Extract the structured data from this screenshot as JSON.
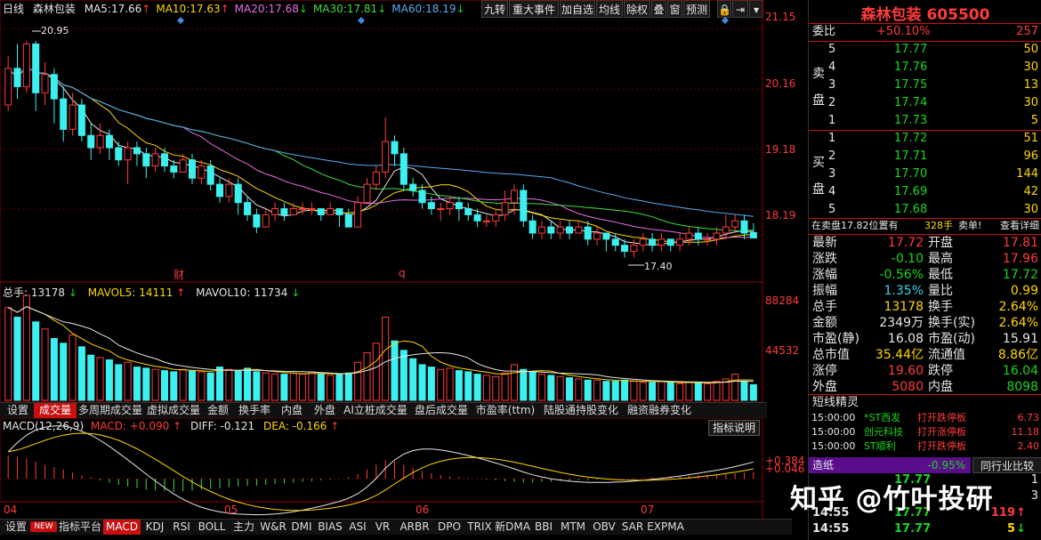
{
  "header": {
    "period": "日线",
    "name": "森林包装",
    "ma": [
      {
        "label": "MA5:",
        "value": "17.66",
        "arrow": "↑",
        "cls": "ma5"
      },
      {
        "label": "MA10:",
        "value": "17.63",
        "arrow": "↑",
        "cls": "ma10"
      },
      {
        "label": "MA20:",
        "value": "17.68",
        "arrow": "↓",
        "cls": "ma20"
      },
      {
        "label": "MA30:",
        "value": "17.81",
        "arrow": "↓",
        "cls": "ma30"
      },
      {
        "label": "MA60:",
        "value": "18.19",
        "arrow": "↓",
        "cls": "ma60"
      }
    ],
    "buttons": [
      "九转",
      "重大事件",
      "加自选",
      "均线",
      "除权",
      "叠",
      "窗",
      "预测"
    ]
  },
  "price_axis": [
    "21.15",
    "20.16",
    "19.18",
    "18.19"
  ],
  "price_annotations": {
    "high": "20.95",
    "low": "17.40",
    "mark_cai": "财",
    "mark_q": "q"
  },
  "volume": {
    "total_label": "总手:",
    "total": "13178",
    "total_arrow": "↓",
    "mavol5_label": "MAVOL5:",
    "mavol5": "14111",
    "mavol5_arrow": "↑",
    "mavol10_label": "MAVOL10:",
    "mavol10": "11734",
    "mavol10_arrow": "↓",
    "axis": [
      "88284",
      "44532"
    ]
  },
  "tabs1": [
    "设置",
    "成交量",
    "多周期成交量",
    "虚拟成交量",
    "金额",
    "换手率",
    "内盘",
    "外盘",
    "AI立桩成交量",
    "盘后成交量",
    "市盈率(ttm)",
    "陆股通持股变化",
    "融资融券变化"
  ],
  "macd": {
    "title": "MACD(12,26,9)",
    "macd_label": "MACD:",
    "macd": "+0.090",
    "diff_label": "DIFF:",
    "diff": "-0.121",
    "dea_label": "DEA:",
    "dea": "-0.166",
    "arrow": "↑",
    "explain": "指标说明",
    "axis": [
      "+0.384",
      "+0.046"
    ]
  },
  "months": [
    "04",
    "05",
    "06",
    "07"
  ],
  "tabs2": [
    "设置",
    "NEW",
    "指标平台",
    "MACD",
    "KDJ",
    "RSI",
    "BOLL",
    "主力",
    "W&R",
    "DMI",
    "BIAS",
    "ASI",
    "VR",
    "ARBR",
    "DPO",
    "TRIX",
    "新DMA",
    "BBI",
    "MTM",
    "OBV",
    "SAR",
    "EXPMA"
  ],
  "panel": {
    "title": "森林包装 605500",
    "weibi_label": "委比",
    "weibi": "+50.10%",
    "weibi_diff": "257",
    "sell_label": [
      "卖",
      "盘"
    ],
    "buy_label": [
      "买",
      "盘"
    ],
    "asks": [
      {
        "lvl": "5",
        "price": "17.77",
        "vol": "50"
      },
      {
        "lvl": "4",
        "price": "17.76",
        "vol": "30"
      },
      {
        "lvl": "3",
        "price": "17.75",
        "vol": "13"
      },
      {
        "lvl": "2",
        "price": "17.74",
        "vol": "30"
      },
      {
        "lvl": "1",
        "price": "17.73",
        "vol": "5"
      }
    ],
    "bids": [
      {
        "lvl": "1",
        "price": "17.72",
        "vol": "51"
      },
      {
        "lvl": "2",
        "price": "17.71",
        "vol": "96"
      },
      {
        "lvl": "3",
        "price": "17.70",
        "vol": "144"
      },
      {
        "lvl": "4",
        "price": "17.69",
        "vol": "42"
      },
      {
        "lvl": "5",
        "price": "17.68",
        "vol": "30"
      }
    ],
    "zaimai": "在卖盘17.82位置有",
    "zaimai_vol": "328手",
    "zaimai_tail": "卖单!",
    "detail": "查看详细",
    "quotes": [
      [
        "最新",
        "17.72",
        "red",
        "开盘",
        "17.81",
        "red"
      ],
      [
        "涨跌",
        "-0.10",
        "grn",
        "最高",
        "17.96",
        "red"
      ],
      [
        "涨幅",
        "-0.56%",
        "grn",
        "最低",
        "17.72",
        "grn"
      ],
      [
        "振幅",
        "1.35%",
        "cyan",
        "量比",
        "0.99",
        "yel"
      ],
      [
        "总手",
        "13178",
        "yel",
        "换手",
        "2.64%",
        "yel"
      ],
      [
        "金额",
        "2349万",
        "wht",
        "换手(实)",
        "2.64%",
        "yel"
      ],
      [
        "市盈(静)",
        "16.08",
        "wht",
        "市盈(动)",
        "15.91",
        "wht"
      ],
      [
        "总市值",
        "35.44亿",
        "yel",
        "流通值",
        "8.86亿",
        "yel"
      ],
      [
        "涨停",
        "19.60",
        "red",
        "跌停",
        "16.04",
        "grn"
      ],
      [
        "外盘",
        "5080",
        "red",
        "内盘",
        "8098",
        "grn"
      ]
    ],
    "elf_title": "短线精灵",
    "elf": [
      {
        "time": "15:00:00",
        "name": "*ST西发",
        "event": "打开跌停板",
        "val": "6.73"
      },
      {
        "time": "15:00:00",
        "name": "创元科技",
        "event": "打开涨停板",
        "val": "11.18"
      },
      {
        "time": "15:00:00",
        "name": "ST顺利",
        "event": "打开跌停板",
        "val": "2.40"
      }
    ],
    "industry_name": "造纸",
    "industry_pct": "-0.95%",
    "industry_btn": "同行业比较",
    "ticks": [
      {
        "time": "14:55",
        "price": "17.77",
        "vol": "119",
        "dir": "↑"
      },
      {
        "time": "14:55",
        "price": "17.77",
        "vol": "5",
        "dir": "↓"
      }
    ],
    "tick_partial": "17.77",
    "tick_side": [
      "1",
      "3",
      "1"
    ]
  },
  "watermark": "知乎 @竹叶投研",
  "chart_data": {
    "type": "candlestick",
    "colors": {
      "up": "#ff3b3b",
      "down": "#3cf0f0",
      "ma5": "#e6e6e6",
      "ma10": "#ffd700",
      "ma20": "#e66ee6",
      "ma30": "#3fdc3f",
      "ma60": "#5aaaf0"
    },
    "ylim": [
      17.1,
      21.3
    ],
    "candles": [
      [
        19.9,
        20.5,
        20.7,
        19.8
      ],
      [
        20.5,
        20.2,
        20.9,
        20.0
      ],
      [
        20.2,
        20.9,
        20.95,
        20.1
      ],
      [
        20.9,
        20.1,
        20.95,
        19.8
      ],
      [
        20.1,
        20.4,
        20.6,
        19.9
      ],
      [
        20.4,
        20.0,
        20.5,
        19.6
      ],
      [
        20.0,
        19.5,
        20.2,
        19.3
      ],
      [
        19.5,
        19.9,
        20.1,
        19.4
      ],
      [
        19.9,
        19.4,
        20.0,
        19.3
      ],
      [
        19.4,
        19.2,
        19.6,
        19.0
      ],
      [
        19.2,
        19.4,
        19.6,
        19.1
      ],
      [
        19.4,
        19.2,
        19.5,
        19.0
      ],
      [
        19.2,
        19.0,
        19.3,
        18.9
      ],
      [
        19.0,
        19.2,
        19.3,
        18.6
      ],
      [
        19.2,
        19.1,
        19.3,
        18.9
      ],
      [
        19.1,
        18.9,
        19.2,
        18.7
      ],
      [
        18.9,
        19.1,
        19.2,
        18.8
      ],
      [
        19.1,
        18.9,
        19.2,
        18.8
      ],
      [
        18.9,
        18.8,
        19.0,
        18.7
      ],
      [
        18.8,
        19.0,
        19.1,
        18.8
      ],
      [
        19.0,
        18.7,
        19.1,
        18.6
      ],
      [
        18.7,
        18.9,
        19.0,
        18.6
      ],
      [
        18.9,
        18.6,
        19.0,
        18.5
      ],
      [
        18.6,
        18.4,
        18.7,
        18.3
      ],
      [
        18.4,
        18.6,
        18.7,
        18.3
      ],
      [
        18.6,
        18.3,
        18.7,
        18.1
      ],
      [
        18.3,
        18.1,
        18.4,
        18.0
      ],
      [
        18.1,
        17.9,
        18.2,
        17.8
      ],
      [
        17.9,
        18.1,
        18.2,
        17.9
      ],
      [
        18.1,
        18.2,
        18.3,
        18.0
      ],
      [
        18.2,
        18.1,
        18.3,
        18.0
      ],
      [
        18.1,
        18.2,
        18.3,
        18.1
      ],
      [
        18.2,
        18.2,
        18.3,
        18.1
      ],
      [
        18.2,
        18.2,
        18.3,
        18.1
      ],
      [
        18.2,
        18.1,
        18.2,
        18.0
      ],
      [
        18.1,
        18.2,
        18.3,
        18.1
      ],
      [
        18.2,
        18.1,
        18.2,
        17.9
      ],
      [
        18.1,
        17.9,
        18.2,
        17.9
      ],
      [
        17.9,
        18.3,
        18.4,
        17.9
      ],
      [
        18.3,
        18.6,
        18.7,
        18.3
      ],
      [
        18.6,
        18.8,
        18.9,
        18.5
      ],
      [
        18.8,
        19.3,
        19.7,
        18.7
      ],
      [
        19.3,
        19.1,
        19.4,
        18.9
      ],
      [
        19.1,
        18.6,
        19.2,
        18.5
      ],
      [
        18.6,
        18.5,
        18.7,
        18.4
      ],
      [
        18.5,
        18.3,
        18.6,
        18.2
      ],
      [
        18.3,
        18.2,
        18.4,
        18.1
      ],
      [
        18.2,
        18.2,
        18.3,
        18.0
      ],
      [
        18.2,
        18.3,
        18.4,
        18.1
      ],
      [
        18.3,
        18.2,
        18.4,
        18.0
      ],
      [
        18.2,
        18.1,
        18.3,
        18.0
      ],
      [
        18.1,
        18.0,
        18.2,
        17.9
      ],
      [
        18.0,
        18.0,
        18.1,
        17.9
      ],
      [
        18.0,
        18.1,
        18.2,
        17.9
      ],
      [
        18.1,
        18.3,
        18.5,
        18.0
      ],
      [
        18.3,
        18.5,
        18.6,
        18.1
      ],
      [
        18.5,
        18.0,
        18.6,
        17.9
      ],
      [
        18.0,
        17.8,
        18.1,
        17.7
      ],
      [
        17.8,
        17.9,
        18.0,
        17.7
      ],
      [
        17.9,
        17.8,
        18.0,
        17.7
      ],
      [
        17.8,
        17.9,
        18.0,
        17.7
      ],
      [
        17.9,
        17.8,
        18.0,
        17.7
      ],
      [
        17.8,
        17.9,
        18.0,
        17.8
      ],
      [
        17.9,
        17.7,
        18.0,
        17.6
      ],
      [
        17.7,
        17.8,
        17.9,
        17.6
      ],
      [
        17.8,
        17.7,
        17.8,
        17.5
      ],
      [
        17.7,
        17.6,
        17.8,
        17.5
      ],
      [
        17.6,
        17.5,
        17.7,
        17.4
      ],
      [
        17.5,
        17.6,
        17.7,
        17.4
      ],
      [
        17.6,
        17.7,
        17.8,
        17.5
      ],
      [
        17.7,
        17.6,
        17.8,
        17.5
      ],
      [
        17.6,
        17.7,
        17.8,
        17.5
      ],
      [
        17.7,
        17.6,
        17.7,
        17.5
      ],
      [
        17.6,
        17.7,
        17.8,
        17.5
      ],
      [
        17.7,
        17.8,
        17.9,
        17.6
      ],
      [
        17.8,
        17.7,
        17.9,
        17.6
      ],
      [
        17.7,
        17.7,
        17.8,
        17.6
      ],
      [
        17.7,
        17.8,
        17.9,
        17.6
      ],
      [
        17.8,
        17.9,
        18.1,
        17.7
      ],
      [
        17.9,
        18.0,
        18.1,
        17.8
      ],
      [
        18.0,
        17.8,
        18.1,
        17.7
      ],
      [
        17.81,
        17.72,
        17.96,
        17.72
      ]
    ],
    "volume": [
      78000,
      70000,
      88284,
      66000,
      60000,
      52000,
      48000,
      55000,
      45000,
      38000,
      36000,
      34000,
      30000,
      32000,
      28000,
      27000,
      26000,
      25000,
      24000,
      26000,
      25000,
      24000,
      23000,
      28000,
      26000,
      25000,
      27000,
      24000,
      23000,
      22000,
      22000,
      23000,
      22000,
      24000,
      22000,
      21000,
      22000,
      23000,
      32000,
      40000,
      48000,
      70000,
      50000,
      42000,
      35000,
      30000,
      28000,
      26000,
      27000,
      25000,
      24000,
      22000,
      21000,
      20000,
      23000,
      30000,
      26000,
      24000,
      22000,
      21000,
      20000,
      19000,
      18000,
      17000,
      17000,
      16000,
      16000,
      17000,
      16000,
      15000,
      15000,
      16000,
      15000,
      14000,
      15000,
      15000,
      14000,
      16000,
      18000,
      22000,
      16000,
      13178
    ],
    "macd_hist": [
      0.3,
      0.28,
      0.26,
      0.22,
      0.18,
      0.15,
      0.12,
      0.08,
      0.04,
      0.02,
      -0.02,
      -0.05,
      -0.08,
      -0.1,
      -0.12,
      -0.14,
      -0.15,
      -0.16,
      -0.17,
      -0.16,
      -0.15,
      -0.14,
      -0.13,
      -0.12,
      -0.11,
      -0.1,
      -0.09,
      -0.09,
      -0.08,
      -0.07,
      -0.06,
      -0.05,
      -0.04,
      -0.03,
      -0.02,
      -0.01,
      0.0,
      0.02,
      0.06,
      0.12,
      0.18,
      0.24,
      0.22,
      0.18,
      0.14,
      0.1,
      0.07,
      0.05,
      0.03,
      0.02,
      0.01,
      0.0,
      -0.01,
      -0.02,
      -0.03,
      -0.04,
      -0.05,
      -0.05,
      -0.04,
      -0.04,
      -0.03,
      -0.03,
      -0.02,
      -0.02,
      -0.01,
      -0.01,
      0.0,
      0.0,
      0.01,
      0.01,
      0.02,
      0.02,
      0.03,
      0.03,
      0.04,
      0.04,
      0.05,
      0.05,
      0.06,
      0.07,
      0.08,
      0.09
    ],
    "macd_ylim": [
      -0.25,
      0.55
    ]
  }
}
